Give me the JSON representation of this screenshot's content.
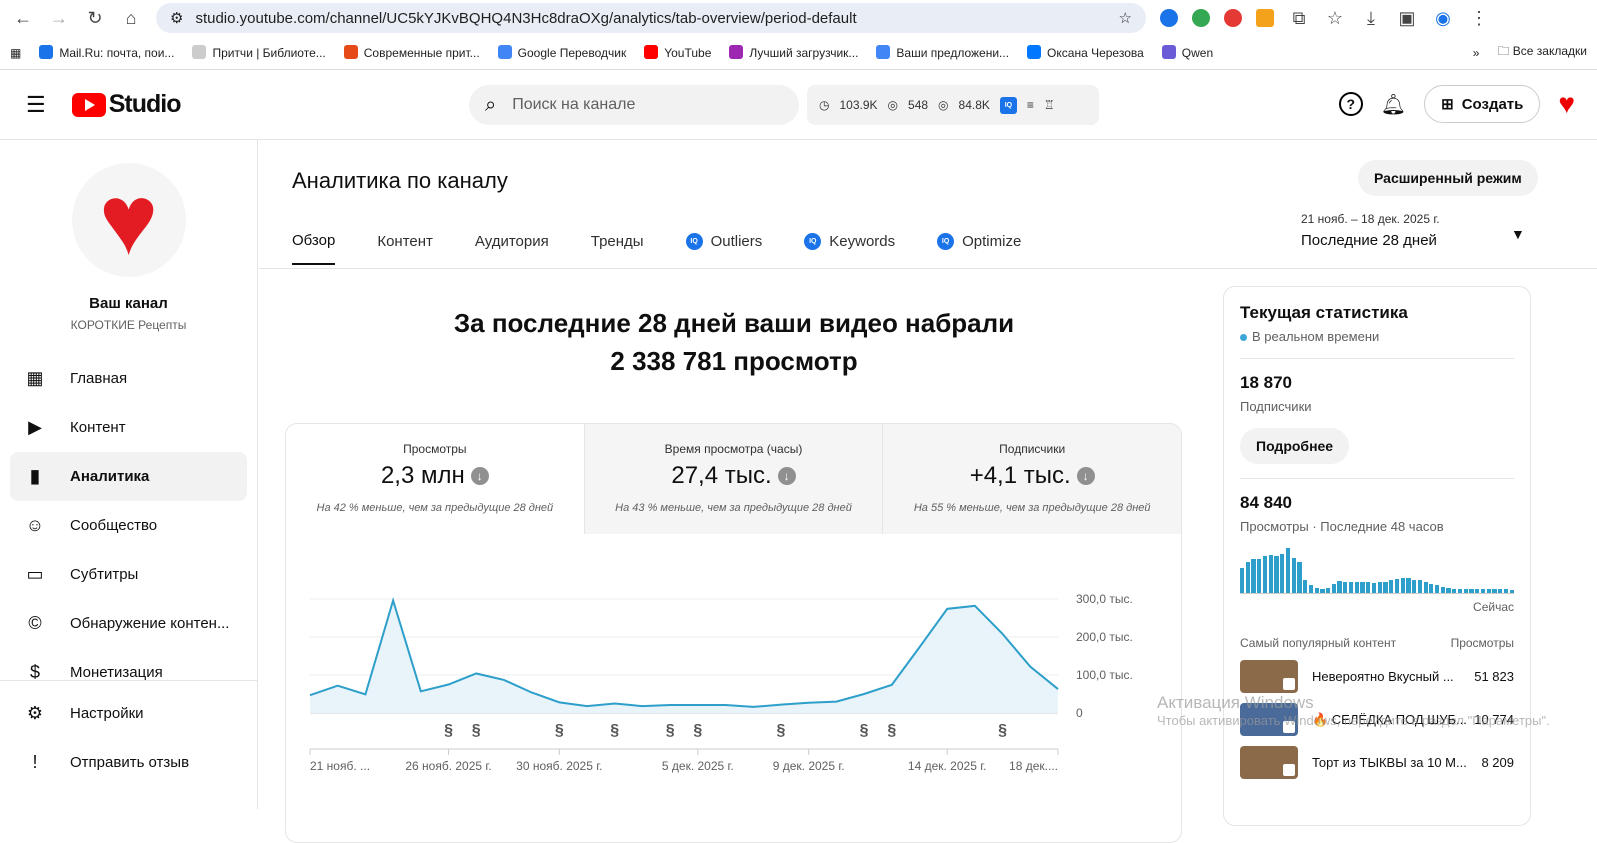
{
  "browser": {
    "url": "studio.youtube.com/channel/UC5kYJKvBQHQ4N3Hc8draOXg/analytics/tab-overview/period-default",
    "bookmarks": [
      "Mail.Ru: почта, пои...",
      "Притчи | Библиоте...",
      "Современные прит...",
      "Google Переводчик",
      "YouTube",
      "Лучший загрузчик...",
      "Ваши предложени...",
      "Оксана Черезова",
      "Qwen"
    ],
    "bookmark_colors": [
      "#1a73e8",
      "#bbb",
      "#e64a19",
      "#4285f4",
      "#f00",
      "#9c27b0",
      "#4285f4",
      "#0077ff",
      "#6b5bd6"
    ],
    "all_bookmarks": "Все закладки"
  },
  "header": {
    "logo": "Studio",
    "search_placeholder": "Поиск на канале",
    "stat_time": "103.9K",
    "stat_views1": "548",
    "stat_views2": "84.8K",
    "create": "Создать"
  },
  "sidebar": {
    "channel_name": "Ваш канал",
    "channel_sub": "КОРОТКИЕ Рецепты",
    "items": [
      {
        "label": "Главная",
        "icon": "▦"
      },
      {
        "label": "Контент",
        "icon": "▶"
      },
      {
        "label": "Аналитика",
        "icon": "▮"
      },
      {
        "label": "Сообщество",
        "icon": "☺"
      },
      {
        "label": "Субтитры",
        "icon": "▭"
      },
      {
        "label": "Обнаружение контен...",
        "icon": "©"
      },
      {
        "label": "Монетизация",
        "icon": "$"
      }
    ],
    "bottom": [
      {
        "label": "Настройки",
        "icon": "⚙"
      },
      {
        "label": "Отправить отзыв",
        "icon": "!"
      }
    ]
  },
  "main": {
    "title": "Аналитика по каналу",
    "advanced": "Расширенный режим",
    "tabs": [
      "Обзор",
      "Контент",
      "Аудитория",
      "Тренды",
      "Outliers",
      "Keywords",
      "Optimize"
    ],
    "period_dates": "21 нояб. – 18 дек. 2025 г.",
    "period_label": "Последние 28 дней",
    "headline1": "За последние 28 дней ваши видео набрали",
    "headline2": "2 338 781 просмотр",
    "metrics": [
      {
        "label": "Просмотры",
        "value": "2,3 млн",
        "compare": "На 42 % меньше, чем за предыдущие 28 дней"
      },
      {
        "label": "Время просмотра (часы)",
        "value": "27,4 тыс.",
        "compare": "На 43 % меньше, чем за предыдущие 28 дней"
      },
      {
        "label": "Подписчики",
        "value": "+4,1 тыс.",
        "compare": "На 55 % меньше, чем за предыдущие 28 дней"
      }
    ]
  },
  "chart_data": {
    "type": "area",
    "title": "Просмотры",
    "ylim": [
      0,
      300000
    ],
    "yticks": [
      {
        "v": 0,
        "label": "0"
      },
      {
        "v": 100000,
        "label": "100,0 тыс."
      },
      {
        "v": 200000,
        "label": "200,0 тыс."
      },
      {
        "v": 300000,
        "label": "300,0 тыс."
      }
    ],
    "xticks": [
      {
        "i": 0,
        "label": "21 нояб. ..."
      },
      {
        "i": 5,
        "label": "26 нояб. 2025 г."
      },
      {
        "i": 9,
        "label": "30 нояб. 2025 г."
      },
      {
        "i": 14,
        "label": "5 дек. 2025 г."
      },
      {
        "i": 18,
        "label": "9 дек. 2025 г."
      },
      {
        "i": 23,
        "label": "14 дек. 2025 г."
      },
      {
        "i": 27,
        "label": "18 дек...."
      }
    ],
    "values": [
      47000,
      72000,
      49000,
      296000,
      57000,
      75000,
      104000,
      87000,
      54000,
      28000,
      18000,
      25000,
      18000,
      21000,
      21000,
      21000,
      16000,
      22000,
      27000,
      30000,
      50000,
      74000,
      173000,
      274000,
      282000,
      208000,
      122000,
      63000
    ],
    "shorts_markers": [
      5,
      6,
      9,
      11,
      13,
      14,
      17,
      20,
      21,
      25
    ],
    "color": "#2d9fca"
  },
  "realtime": {
    "title": "Текущая статистика",
    "live": "В реальном времени",
    "subs": "18 870",
    "subs_label": "Подписчики",
    "more": "Подробнее",
    "views": "84 840",
    "views_label": "Просмотры · Последние 48 часов",
    "now": "Сейчас",
    "bars": [
      55,
      70,
      75,
      75,
      82,
      85,
      83,
      87,
      100,
      78,
      68,
      28,
      18,
      12,
      10,
      12,
      20,
      26,
      24,
      24,
      24,
      24,
      24,
      23,
      24,
      25,
      28,
      32,
      33,
      33,
      30,
      28,
      25,
      20,
      17,
      14,
      12,
      10,
      8,
      8,
      8,
      8,
      8,
      9,
      10,
      10,
      10,
      6
    ],
    "popular_header": "Самый популярный контент",
    "popular_views_header": "Просмотры",
    "popular": [
      {
        "title": "Невероятно Вкусный ...",
        "views": "51 823",
        "thumb": "#8b6a4a"
      },
      {
        "title": "🔥 СЕЛЁДКА ПОД ШУБ...",
        "views": "10 774",
        "thumb": "#4a6a9a"
      },
      {
        "title": "Торт из ТЫКВЫ за 10 М...",
        "views": "8 209",
        "thumb": "#8b6a4a"
      }
    ]
  },
  "watermark": {
    "line1": "Активация Windows",
    "line2": "Чтобы активировать Windows, перейдите в раздел \"Параметры\"."
  }
}
